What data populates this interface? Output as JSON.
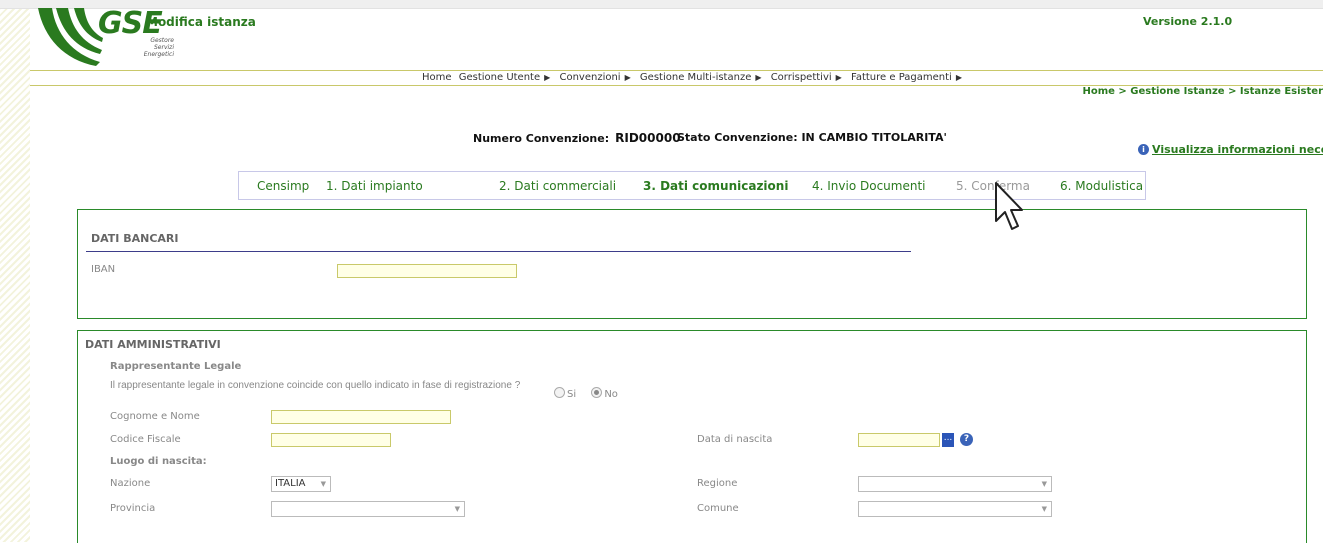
{
  "header": {
    "logo_text": "GSE",
    "logo_sub": [
      "Gestore",
      "Servizi",
      "Energetici"
    ],
    "app_title": "Modifica istanza",
    "version": "Versione 2.1.0"
  },
  "menu": {
    "items": [
      "Home",
      "Gestione Utente",
      "Convenzioni",
      "Gestione Multi-istanze",
      "Corrispettivi",
      "Fatture e Pagamenti"
    ]
  },
  "breadcrumb": "Home > Gestione Istanze > Istanze Esister",
  "convention": {
    "number_label": "Numero Convenzione:",
    "number_value": "RID00000",
    "status_label": "Stato Convenzione:",
    "status_value": "IN CAMBIO TITOLARITA'"
  },
  "info_link": "Visualizza informazioni necessari",
  "steps": [
    "Censimp",
    "1. Dati impianto",
    "2. Dati commerciali",
    "3. Dati comunicazioni",
    "4. Invio Documenti",
    "5. Conferma",
    "6. Modulistica"
  ],
  "dati_bancari": {
    "title": "DATI BANCARI",
    "iban_label": "IBAN",
    "iban_value": ""
  },
  "dati_amministrativi": {
    "title": "DATI AMMINISTRATIVI",
    "subtitle": "Rappresentante Legale",
    "question": "Il rappresentante legale in convenzione coincide con quello indicato in fase di registrazione ?",
    "radio_si": "Si",
    "radio_no": "No",
    "cognome_label": "Cognome e Nome",
    "codice_label": "Codice Fiscale",
    "data_nascita_label": "Data di nascita",
    "luogo_label": "Luogo di nascita:",
    "nazione_label": "Nazione",
    "nazione_value": "ITALIA",
    "regione_label": "Regione",
    "provincia_label": "Provincia",
    "comune_label": "Comune",
    "cal_button": "...",
    "help_icon": "?"
  },
  "icons": {
    "info": "info-icon",
    "help": "help-icon",
    "calendar": "calendar-button",
    "cursor": "mouse-pointer-icon"
  },
  "colors": {
    "brand_green": "#2a7a1f",
    "panel_border": "#2a8a2a",
    "input_fill": "#ffffe6",
    "step_border": "#c8c8e8"
  }
}
